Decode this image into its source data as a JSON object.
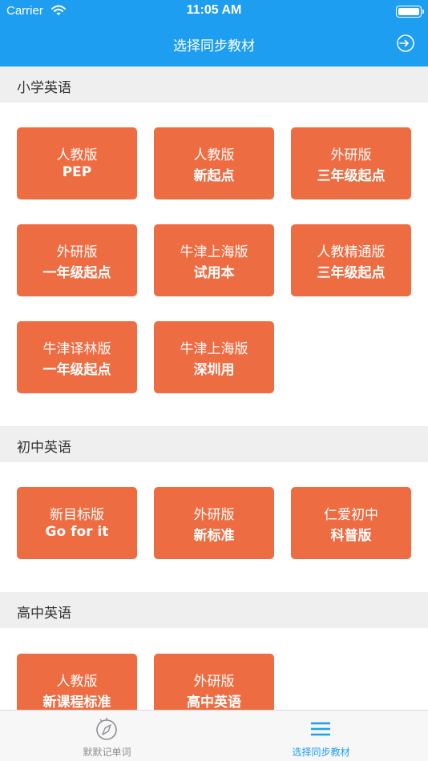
{
  "status_bar": {
    "carrier": "Carrier",
    "time": "11:05 AM"
  },
  "nav": {
    "title": "选择同步教材",
    "right_icon": "exit-icon"
  },
  "sections": [
    {
      "title": "小学英语",
      "books": [
        {
          "line1": "人教版",
          "line2": "PEP"
        },
        {
          "line1": "人教版",
          "line2": "新起点"
        },
        {
          "line1": "外研版",
          "line2": "三年级起点"
        },
        {
          "line1": "外研版",
          "line2": "一年级起点"
        },
        {
          "line1": "牛津上海版",
          "line2": "试用本"
        },
        {
          "line1": "人教精通版",
          "line2": "三年级起点"
        },
        {
          "line1": "牛津译林版",
          "line2": "一年级起点"
        },
        {
          "line1": "牛津上海版",
          "line2": "深圳用"
        }
      ]
    },
    {
      "title": "初中英语",
      "books": [
        {
          "line1": "新目标版",
          "line2": "Go for it"
        },
        {
          "line1": "外研版",
          "line2": "新标准"
        },
        {
          "line1": "仁爱初中",
          "line2": "科普版"
        }
      ]
    },
    {
      "title": "高中英语",
      "books": [
        {
          "line1": "人教版",
          "line2": "新课程标准"
        },
        {
          "line1": "外研版",
          "line2": "高中英语"
        }
      ]
    }
  ],
  "tabbar": {
    "tabs": [
      {
        "label": "默默记单词",
        "icon": "compass-icon",
        "active": false
      },
      {
        "label": "选择同步教材",
        "icon": "menu-icon",
        "active": true
      }
    ]
  },
  "colors": {
    "accent": "#1e9ef0",
    "book": "#ee6c42",
    "section_bg": "#efefef",
    "tab_inactive": "#8e8e93"
  }
}
